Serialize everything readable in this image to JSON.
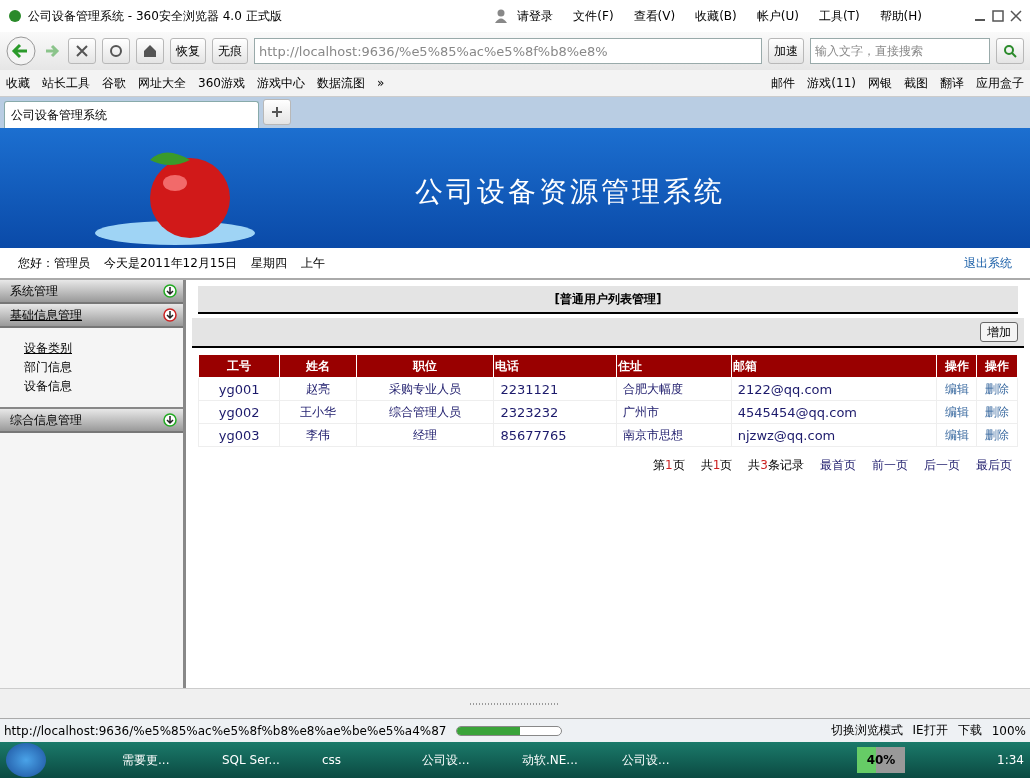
{
  "window": {
    "title": "公司设备管理系统 - 360安全浏览器 4.0 正式版"
  },
  "menu": [
    {
      "label": "请登录",
      "kind": "user"
    },
    {
      "label": "文件(F)",
      "kind": "text"
    },
    {
      "label": "查看(V)",
      "kind": "text"
    },
    {
      "label": "收藏(B)",
      "kind": "text"
    },
    {
      "label": "帐户(U)",
      "kind": "text"
    },
    {
      "label": "工具(T)",
      "kind": "text"
    },
    {
      "label": "帮助(H)",
      "kind": "text"
    }
  ],
  "toolbar": {
    "restore": "恢复",
    "incognito": "无痕",
    "address": "http://localhost:9636/%e5%85%ac%e5%8f%b8%e8%",
    "speed": "加速",
    "search_placeholder": "输入文字，直接搜索"
  },
  "bookmarks": [
    "收藏",
    "站长工具",
    "谷歌",
    "网址大全",
    "360游戏",
    "游戏中心",
    "数据流图",
    "»"
  ],
  "bookmarks_right": [
    "邮件",
    "游戏(11)",
    "网银",
    "截图",
    "翻译",
    "应用盒子"
  ],
  "tabs": [
    {
      "label": "公司设备管理系统",
      "selected": true
    }
  ],
  "banner": {
    "title": "公司设备资源管理系统"
  },
  "info": {
    "greeting": "您好：管理员",
    "date": "今天是2011年12月15日",
    "weekday": "星期四",
    "period": "上午",
    "logout": "退出系统"
  },
  "sidebar": [
    {
      "label": "系统管理",
      "expanded": false
    },
    {
      "label": "基础信息管理",
      "expanded": true,
      "children": [
        "设备类别",
        "部门信息",
        "设备信息"
      ]
    },
    {
      "label": "综合信息管理",
      "expanded": false
    }
  ],
  "content": {
    "title": "[普通用户列表管理]",
    "add_button": "增加",
    "columns": [
      "工号",
      "姓名",
      "职位",
      "电话",
      "住址",
      "邮箱",
      "操作",
      "操作"
    ],
    "rows": [
      [
        "yg001",
        "赵亮",
        "采购专业人员",
        "2231121",
        "合肥大幅度",
        "2122@qq.com",
        "编辑",
        "删除"
      ],
      [
        "yg002",
        "王小华",
        "综合管理人员",
        "2323232",
        "广州市",
        "4545454@qq.com",
        "编辑",
        "删除"
      ],
      [
        "yg003",
        "李伟",
        "经理",
        "85677765",
        "南京市思想",
        "njzwz@qq.com",
        "编辑",
        "删除"
      ]
    ],
    "pager": [
      {
        "pre": "第",
        "num": "1",
        "post": "页"
      },
      {
        "pre": "共",
        "num": "1",
        "post": "页"
      },
      {
        "pre": "共",
        "num": "3",
        "post": "条记录"
      }
    ],
    "pager_links": [
      "最首页",
      "前一页",
      "后一页",
      "最后页"
    ]
  },
  "status": {
    "url": "http://localhost:9636/%e5%85%ac%e5%8f%b8%e8%ae%be%e5%a4%87",
    "level": 0.6,
    "mode": "切换浏览模式",
    "ie": "IE打开",
    "download": "下载",
    "zoom": "100%"
  },
  "taskbar": {
    "items": [
      "需要更...",
      "SQL Ser...",
      "css",
      "公司设...",
      "动软.NE...",
      "公司设..."
    ],
    "battery": "40%",
    "clock": "1:34"
  }
}
